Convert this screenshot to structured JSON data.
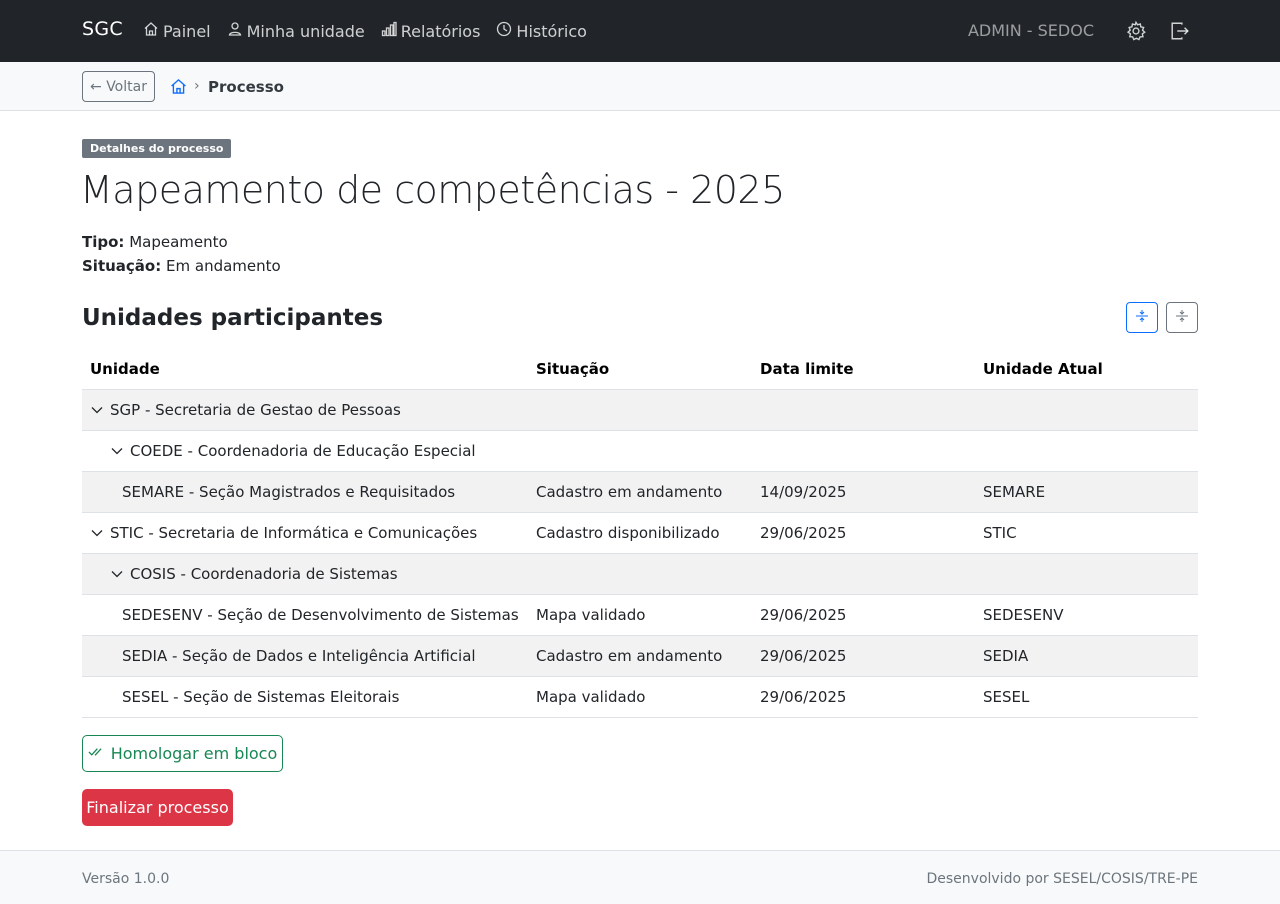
{
  "navbar": {
    "brand": "SGC",
    "items": [
      {
        "label": "Painel",
        "icon": "house-icon"
      },
      {
        "label": "Minha unidade",
        "icon": "person-icon"
      },
      {
        "label": "Relatórios",
        "icon": "bar-chart-icon"
      },
      {
        "label": "Histórico",
        "icon": "clock-icon"
      }
    ],
    "user": "ADMIN - SEDOC",
    "settings_icon": "gear-icon",
    "logout_icon": "logout-icon"
  },
  "breadcrumb": {
    "back_label": "← Voltar",
    "separator": "›",
    "current": "Processo"
  },
  "process": {
    "badge": "Detalhes do processo",
    "title": "Mapeamento de competências - 2025",
    "tipo_label": "Tipo:",
    "tipo_value": "Mapeamento",
    "situacao_label": "Situação:",
    "situacao_value": "Em andamento"
  },
  "units": {
    "title": "Unidades participantes",
    "expand_icon": "expand-all-icon",
    "collapse_icon": "collapse-all-icon",
    "columns": [
      "Unidade",
      "Situação",
      "Data limite",
      "Unidade Atual"
    ],
    "rows": [
      {
        "unit": "SGP - Secretaria de Gestao de Pessoas",
        "situacao": "",
        "data": "",
        "atual": "",
        "level": 0,
        "expandable": true
      },
      {
        "unit": "COEDE - Coordenadoria de Educação Especial",
        "situacao": "",
        "data": "",
        "atual": "",
        "level": 1,
        "expandable": true
      },
      {
        "unit": "SEMARE - Seção Magistrados e Requisitados",
        "situacao": "Cadastro em andamento",
        "data": "14/09/2025",
        "atual": "SEMARE",
        "level": 2,
        "expandable": false
      },
      {
        "unit": "STIC - Secretaria de Informática e Comunicações",
        "situacao": "Cadastro disponibilizado",
        "data": "29/06/2025",
        "atual": "STIC",
        "level": 0,
        "expandable": true
      },
      {
        "unit": "COSIS - Coordenadoria de Sistemas",
        "situacao": "",
        "data": "",
        "atual": "",
        "level": 1,
        "expandable": true
      },
      {
        "unit": "SEDESENV - Seção de Desenvolvimento de Sistemas",
        "situacao": "Mapa validado",
        "data": "29/06/2025",
        "atual": "SEDESENV",
        "level": 2,
        "expandable": false
      },
      {
        "unit": "SEDIA - Seção de Dados e Inteligência Artificial",
        "situacao": "Cadastro em andamento",
        "data": "29/06/2025",
        "atual": "SEDIA",
        "level": 2,
        "expandable": false
      },
      {
        "unit": "SESEL - Seção de Sistemas Eleitorais",
        "situacao": "Mapa validado",
        "data": "29/06/2025",
        "atual": "SESEL",
        "level": 2,
        "expandable": false
      }
    ]
  },
  "actions": {
    "homologar": "Homologar em bloco",
    "homologar_icon": "check-all-icon",
    "finalizar": "Finalizar processo"
  },
  "footer": {
    "version": "Versão 1.0.0",
    "credit": "Desenvolvido por SESEL/COSIS/TRE-PE"
  },
  "colors": {
    "navbar_bg": "#212529",
    "primary": "#0d6efd",
    "success": "#198754",
    "danger": "#dc3545",
    "secondary": "#6c757d"
  }
}
